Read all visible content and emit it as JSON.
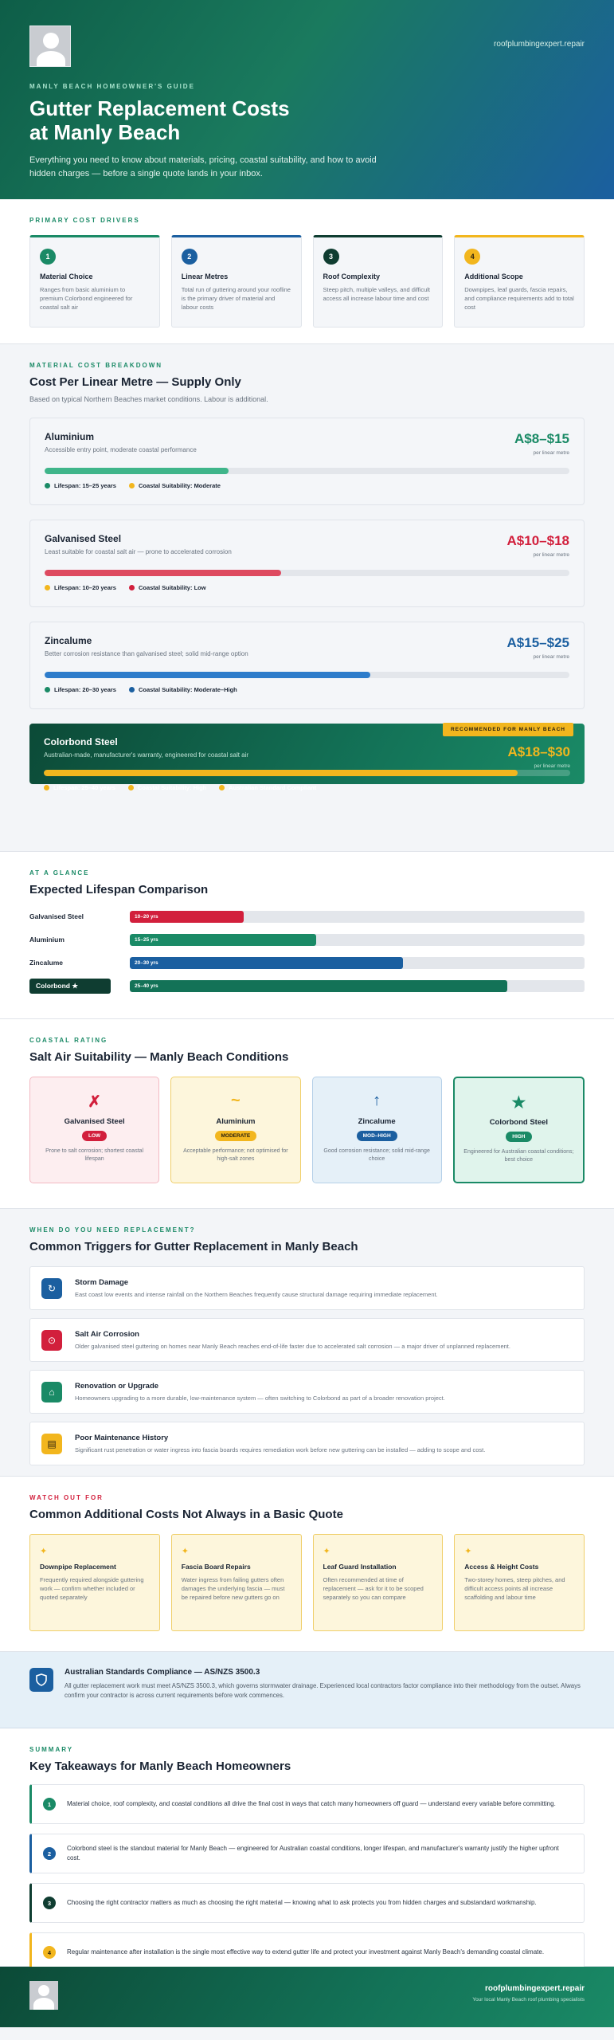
{
  "hero": {
    "site": "roofplumbingexpert.repair",
    "eyebrow": "MANLY BEACH HOMEOWNER'S GUIDE",
    "title_line1": "Gutter Replacement Costs",
    "title_line2": "at Manly Beach",
    "intro": "Everything you need to know about materials, pricing, coastal suitability, and how to avoid hidden charges — before a single quote lands in your inbox."
  },
  "drivers": {
    "eyebrow": "PRIMARY COST DRIVERS",
    "items": [
      {
        "n": "1",
        "title": "Material Choice",
        "desc": "Ranges from basic aluminium to premium Colorbond engineered for coastal salt air",
        "color": "#1a8a66"
      },
      {
        "n": "2",
        "title": "Linear Metres",
        "desc": "Total run of guttering around your roofline is the primary driver of material and labour costs",
        "color": "#1b5fa0"
      },
      {
        "n": "3",
        "title": "Roof Complexity",
        "desc": "Steep pitch, multiple valleys, and difficult access all increase labour time and cost",
        "color": "#0f3d31"
      },
      {
        "n": "4",
        "title": "Additional Scope",
        "desc": "Downpipes, leaf guards, fascia repairs, and compliance requirements add to total cost",
        "color": "#f2b61e"
      }
    ]
  },
  "materials": {
    "eyebrow": "MATERIAL COST BREAKDOWN",
    "title": "Cost Per Linear Metre — Supply Only",
    "sub": "Based on typical Northern Beaches market conditions. Labour is additional.",
    "unit": "per linear metre",
    "items": [
      {
        "name": "Aluminium",
        "desc": "Accessible entry point, moderate coastal performance",
        "price": "A$8–$15",
        "price_color": "#1a8a66",
        "fill": 0.35,
        "fill_color": "#3fb58a",
        "tag1": "Lifespan: 15–25 years",
        "tag1_color": "#1a8a66",
        "tag2": "Coastal Suitability: Moderate",
        "tag2_color": "#f2b61e"
      },
      {
        "name": "Galvanised Steel",
        "desc": "Least suitable for coastal salt air — prone to accelerated corrosion",
        "price": "A$10–$18",
        "price_color": "#d21f3c",
        "fill": 0.45,
        "fill_color": "#de4a60",
        "tag1": "Lifespan: 10–20 years",
        "tag1_color": "#f2b61e",
        "tag2": "Coastal Suitability: Low",
        "tag2_color": "#d21f3c"
      },
      {
        "name": "Zincalume",
        "desc": "Better corrosion resistance than galvanised steel; solid mid-range option",
        "price": "A$15–$25",
        "price_color": "#1b5fa0",
        "fill": 0.62,
        "fill_color": "#2d7ccb",
        "tag1": "Lifespan: 20–30 years",
        "tag1_color": "#1a8a66",
        "tag2": "Coastal Suitability: Moderate–High",
        "tag2_color": "#1b5fa0"
      }
    ],
    "featured": {
      "badge": "RECOMMENDED FOR MANLY BEACH",
      "name": "Colorbond Steel",
      "desc": "Australian-made, manufacturer's warranty, engineered for coastal salt air",
      "price": "A$18–$30",
      "fill": 0.9,
      "tag1": "Lifespan: 25–40 years",
      "tag2": "Coastal Suitability: High",
      "tag3": "Australian Standard Compliant"
    }
  },
  "lifespan": {
    "eyebrow": "AT A GLANCE",
    "title": "Expected Lifespan Comparison",
    "rows": [
      {
        "label": "Galvanised Steel",
        "value": "10–20 yrs",
        "fill": 0.25,
        "color": "#d21f3c"
      },
      {
        "label": "Aluminium",
        "value": "15–25 yrs",
        "fill": 0.41,
        "color": "#1a8a66"
      },
      {
        "label": "Zincalume",
        "value": "20–30 yrs",
        "fill": 0.6,
        "color": "#1b5fa0"
      }
    ],
    "featured": {
      "label": "Colorbond ★",
      "value": "25–40 yrs",
      "fill": 0.83,
      "color": "#137257"
    }
  },
  "salt": {
    "eyebrow": "COASTAL RATING",
    "title": "Salt Air Suitability — Manly Beach Conditions",
    "cards": [
      {
        "sym": "✗",
        "name": "Galvanised Steel",
        "pill": "LOW",
        "desc": "Prone to salt corrosion; shortest coastal lifespan",
        "bg": "#fdeef0",
        "border": "#f3b9c2",
        "accent": "#d21f3c",
        "pill_text": "#ffffff"
      },
      {
        "sym": "~",
        "name": "Aluminium",
        "pill": "MODERATE",
        "desc": "Acceptable performance; not optimised for high-salt zones",
        "bg": "#fdf6dc",
        "border": "#f0cf6a",
        "accent": "#f2b61e",
        "pill_text": "#2b2210"
      },
      {
        "sym": "↑",
        "name": "Zincalume",
        "pill": "MOD–HIGH",
        "desc": "Good corrosion resistance; solid mid-range choice",
        "bg": "#e5f0f8",
        "border": "#b5d0e8",
        "accent": "#1b5fa0",
        "pill_text": "#ffffff"
      },
      {
        "sym": "★",
        "name": "Colorbond Steel",
        "pill": "HIGH",
        "desc": "Engineered for Australian coastal conditions; best choice",
        "bg": "#e0f4ec",
        "border": "#1a8a66",
        "accent": "#1a8a66",
        "pill_text": "#ffffff"
      }
    ]
  },
  "triggers": {
    "eyebrow": "WHEN DO YOU NEED REPLACEMENT?",
    "title": "Common Triggers for Gutter Replacement in Manly Beach",
    "items": [
      {
        "icon": "↻",
        "title": "Storm Damage",
        "desc": "East coast low events and intense rainfall on the Northern Beaches frequently cause structural damage requiring immediate replacement.",
        "color": "#1b5fa0"
      },
      {
        "icon": "⊙",
        "title": "Salt Air Corrosion",
        "desc": "Older galvanised steel guttering on homes near Manly Beach reaches end-of-life faster due to accelerated salt corrosion — a major driver of unplanned replacement.",
        "color": "#d21f3c"
      },
      {
        "icon": "⌂",
        "title": "Renovation or Upgrade",
        "desc": "Homeowners upgrading to a more durable, low-maintenance system — often switching to Colorbond as part of a broader renovation project.",
        "color": "#1a8a66"
      },
      {
        "icon": "▤",
        "title": "Poor Maintenance History",
        "desc": "Significant rust penetration or water ingress into fascia boards requires remediation work before new guttering can be installed — adding to scope and cost.",
        "color": "#f2b61e"
      }
    ]
  },
  "extras": {
    "eyebrow": "WATCH OUT FOR",
    "title": "Common Additional Costs Not Always in a Basic Quote",
    "items": [
      {
        "title": "Downpipe Replacement",
        "desc": "Frequently required alongside guttering work — confirm whether included or quoted separately"
      },
      {
        "title": "Fascia Board Repairs",
        "desc": "Water ingress from failing gutters often damages the underlying fascia — must be repaired before new gutters go on"
      },
      {
        "title": "Leaf Guard Installation",
        "desc": "Often recommended at time of replacement — ask for it to be scoped separately so you can compare"
      },
      {
        "title": "Access & Height Costs",
        "desc": "Two-storey homes, steep pitches, and difficult access points all increase scaffolding and labour time"
      }
    ]
  },
  "compliance": {
    "title": "Australian Standards Compliance — AS/NZS 3500.3",
    "desc": "All gutter replacement work must meet AS/NZS 3500.3, which governs stormwater drainage. Experienced local contractors factor compliance into their methodology from the outset. Always confirm your contractor is across current requirements before work commences."
  },
  "summary": {
    "eyebrow": "SUMMARY",
    "title": "Key Takeaways for Manly Beach Homeowners",
    "items": [
      {
        "n": "1",
        "text": "Material choice, roof complexity, and coastal conditions all drive the final cost in ways that catch many homeowners off guard — understand every variable before committing.",
        "color": "#1a8a66"
      },
      {
        "n": "2",
        "text": "Colorbond steel is the standout material for Manly Beach — engineered for Australian coastal conditions, longer lifespan, and manufacturer's warranty justify the higher upfront cost.",
        "color": "#1b5fa0"
      },
      {
        "n": "3",
        "text": "Choosing the right contractor matters as much as choosing the right material — knowing what to ask protects you from hidden charges and substandard workmanship.",
        "color": "#0f3d31"
      },
      {
        "n": "4",
        "text": "Regular maintenance after installation is the single most effective way to extend gutter life and protect your investment against Manly Beach's demanding coastal climate.",
        "color": "#f2b61e"
      }
    ]
  },
  "footer": {
    "site": "roofplumbingexpert.repair",
    "tagline": "Your local Manly Beach roof plumbing specialists"
  }
}
